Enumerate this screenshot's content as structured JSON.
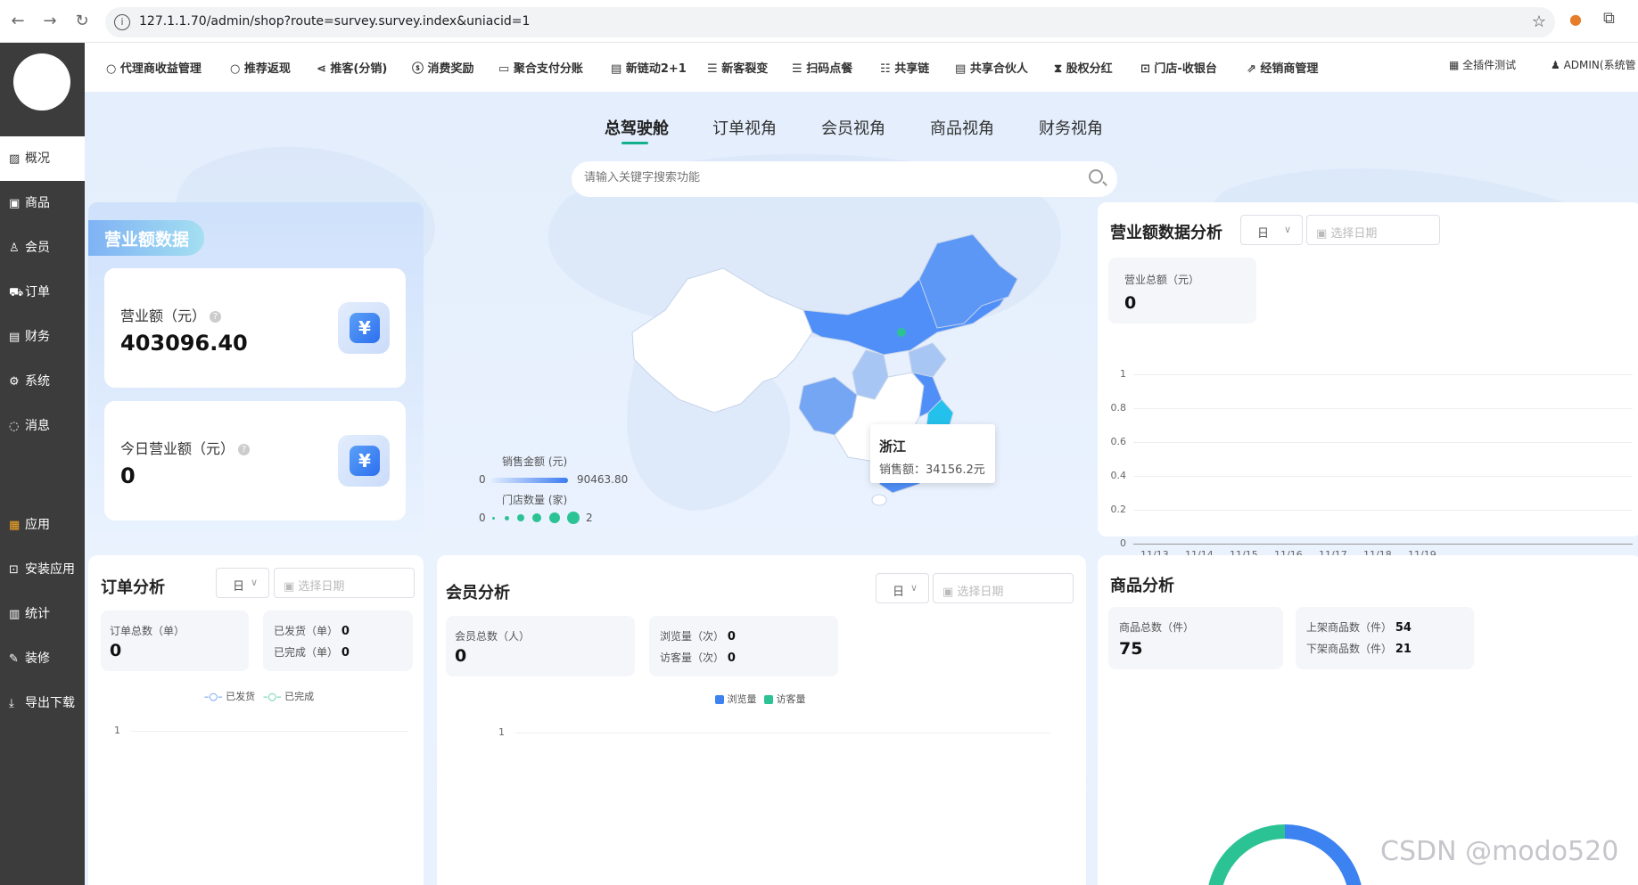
{
  "browser": {
    "url": "127.1.1.70/admin/shop?route=survey.survey.index&uniacid=1"
  },
  "sidebar": {
    "items": [
      {
        "label": "概况",
        "icon": "chart-icon"
      },
      {
        "label": "商品",
        "icon": "goods-icon"
      },
      {
        "label": "会员",
        "icon": "user-icon"
      },
      {
        "label": "订单",
        "icon": "cart-icon"
      },
      {
        "label": "财务",
        "icon": "finance-icon"
      },
      {
        "label": "系统",
        "icon": "gear-icon"
      },
      {
        "label": "消息",
        "icon": "message-icon"
      },
      {
        "label": "应用",
        "icon": "apps-icon"
      },
      {
        "label": "安装应用",
        "icon": "install-icon"
      },
      {
        "label": "统计",
        "icon": "stats-icon"
      },
      {
        "label": "装修",
        "icon": "brush-icon"
      },
      {
        "label": "导出下载",
        "icon": "download-icon"
      }
    ]
  },
  "topnav": {
    "items": [
      "代理商收益管理",
      "推荐返现",
      "推客(分销)",
      "消费奖励",
      "聚合支付分账",
      "新链动2+1",
      "新客裂变",
      "扫码点餐",
      "共享链",
      "共享合伙人",
      "股权分红",
      "门店-收银台",
      "经销商管理"
    ],
    "plugin_test": "全插件测试",
    "user": "ADMIN(系统管"
  },
  "tabs": [
    "总驾驶舱",
    "订单视角",
    "会员视角",
    "商品视角",
    "财务视角"
  ],
  "search": {
    "placeholder": "请输入关键字搜索功能"
  },
  "revenue_card": {
    "title": "营业额数据",
    "total_label": "营业额（元）",
    "total_value": "403096.40",
    "today_label": "今日营业额（元）",
    "today_value": "0"
  },
  "map": {
    "legend_sales_title": "销售金额 (元)",
    "legend_sales_min": "0",
    "legend_sales_max": "90463.80",
    "legend_store_title": "门店数量 (家)",
    "legend_store_min": "0",
    "legend_store_max": "2",
    "tooltip_title": "浙江",
    "tooltip_value": "销售额：34156.2元",
    "colors": {
      "high": "#4f8ff7",
      "mid": "#8fb6f4",
      "zhejiang": "#24c1ec"
    }
  },
  "revenue_analysis": {
    "title": "营业额数据分析",
    "period": "日",
    "date_placeholder": "选择日期",
    "total_label": "营业总额（元）",
    "total_value": "0",
    "y_ticks": [
      "1",
      "0.8",
      "0.6",
      "0.4",
      "0.2",
      "0"
    ],
    "x_ticks": [
      "11/13",
      "11/14",
      "11/15",
      "11/16",
      "11/17",
      "11/18",
      "11/19"
    ]
  },
  "order_analysis": {
    "title": "订单分析",
    "period": "日",
    "date_placeholder": "选择日期",
    "total_label": "订单总数（单）",
    "total_value": "0",
    "shipped_label": "已发货（单）",
    "shipped_value": "0",
    "completed_label": "已完成（单）",
    "completed_value": "0",
    "legend_shipped": "已发货",
    "legend_completed": "已完成",
    "y_top": "1"
  },
  "member_analysis": {
    "title": "会员分析",
    "period": "日",
    "date_placeholder": "选择日期",
    "total_label": "会员总数（人）",
    "total_value": "0",
    "views_label": "浏览量（次）",
    "views_value": "0",
    "visitors_label": "访客量（次）",
    "visitors_value": "0",
    "legend_views": "浏览量",
    "legend_visitors": "访客量",
    "y_top": "1"
  },
  "goods_analysis": {
    "title": "商品分析",
    "total_label": "商品总数（件）",
    "total_value": "75",
    "on_label": "上架商品数（件）",
    "on_value": "54",
    "off_label": "下架商品数（件）",
    "off_value": "21"
  },
  "watermark": "CSDN @modo520"
}
